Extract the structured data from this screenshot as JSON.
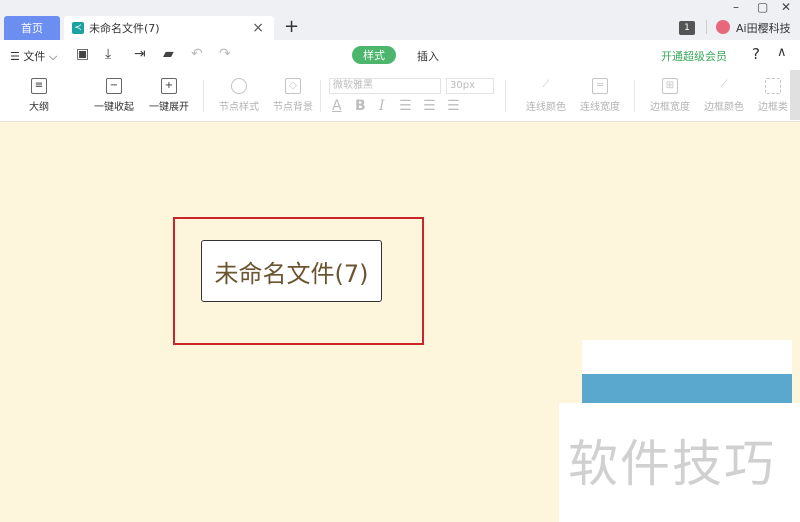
{
  "tabs": {
    "home": "首页",
    "document": "未命名文件(7)",
    "close": "×",
    "new_tab": "+"
  },
  "window": {
    "minimize": "–",
    "maximize": "▢",
    "close": "✕",
    "badge": "1",
    "user_name": "Ai田樱科技"
  },
  "menubar": {
    "file": "☰ 文件 ⌵",
    "mode_style": "样式",
    "mode_insert": "插入",
    "vip": "开通超级会员",
    "help": "?",
    "collapse": "∧"
  },
  "toolbar": {
    "outline": "大纲",
    "collapse_all": "一键收起",
    "expand_all": "一键展开",
    "node_style": "节点样式",
    "node_background": "节点背景",
    "font_family": "微软雅黑",
    "font_size": "30px",
    "line_color": "连线颜色",
    "line_width": "连线宽度",
    "border_width": "边框宽度",
    "border_color": "边框颜色",
    "border_type": "边框类"
  },
  "canvas": {
    "root_node": "未命名文件(7)"
  },
  "watermark": "软件技巧",
  "colors": {
    "accent_green": "#4cb66d",
    "home_tab": "#6b8ef0",
    "canvas_bg": "#fdf5dc",
    "highlight": "#c8262a"
  }
}
